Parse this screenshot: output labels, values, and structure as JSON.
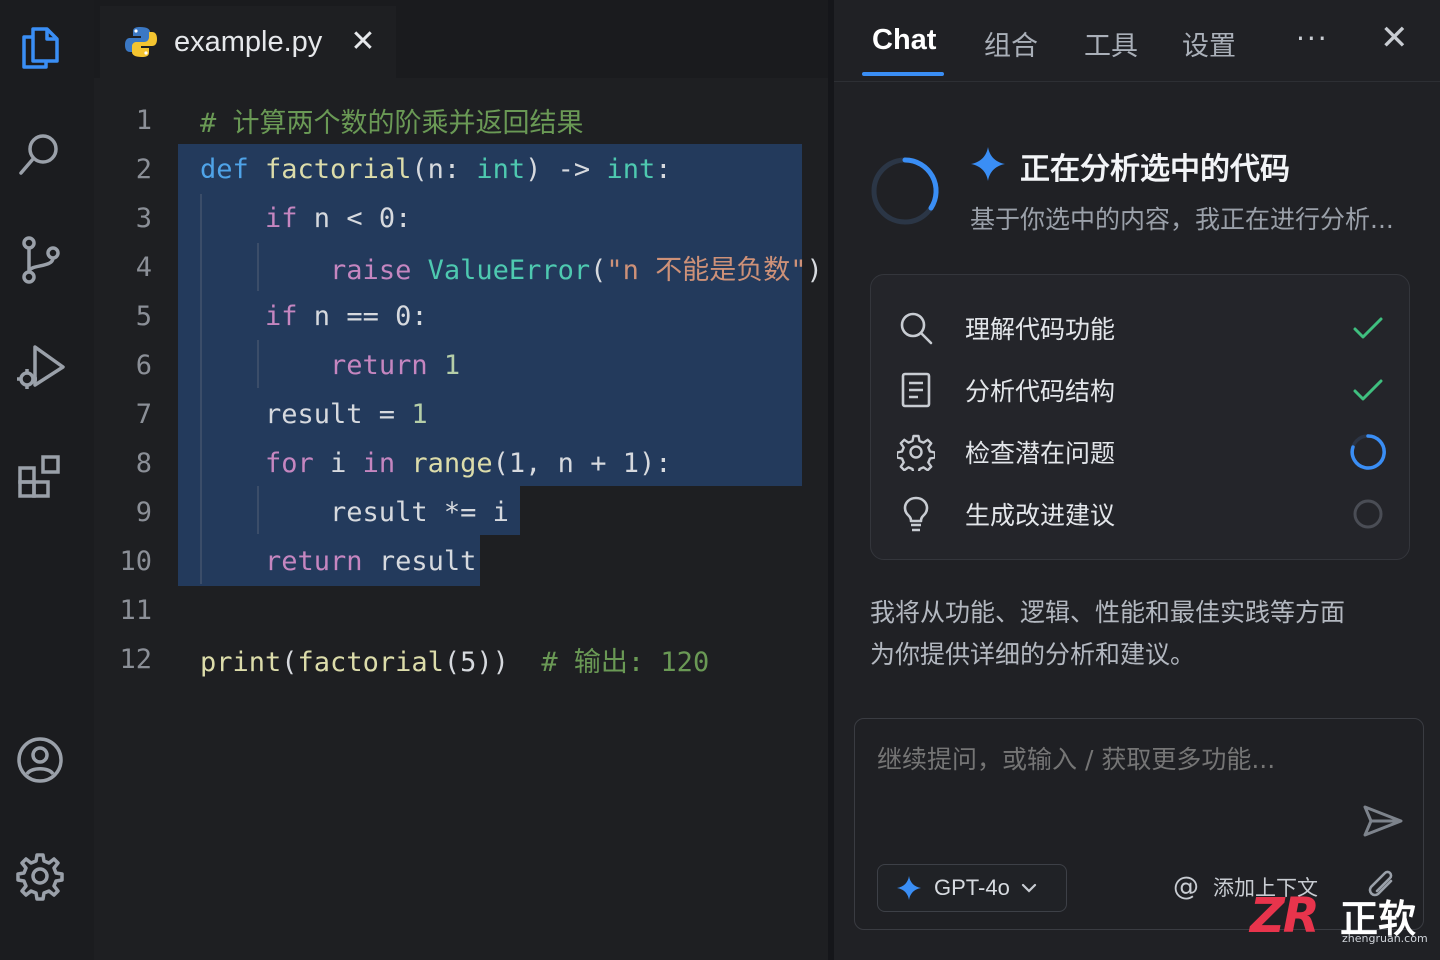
{
  "editor": {
    "tab": {
      "file_name": "example.py",
      "close_glyph": "✕",
      "file_icon": "python-icon"
    },
    "lines": [
      {
        "n": "1",
        "tokens": [
          {
            "t": "# 计算两个数的阶乘并返回结果",
            "c": "cm"
          }
        ]
      },
      {
        "n": "2",
        "tokens": [
          {
            "t": "def ",
            "c": "kw"
          },
          {
            "t": "factorial",
            "c": "fn"
          },
          {
            "t": "(n: ",
            "c": "pl"
          },
          {
            "t": "int",
            "c": "ty"
          },
          {
            "t": ") -> ",
            "c": "pl"
          },
          {
            "t": "int",
            "c": "ty"
          },
          {
            "t": ":",
            "c": "pl"
          }
        ]
      },
      {
        "n": "3",
        "tokens": [
          {
            "t": "    ",
            "c": "pl"
          },
          {
            "t": "if",
            "c": "kwp"
          },
          {
            "t": " n < 0:",
            "c": "pl"
          }
        ]
      },
      {
        "n": "4",
        "tokens": [
          {
            "t": "        ",
            "c": "pl"
          },
          {
            "t": "raise ",
            "c": "kwp"
          },
          {
            "t": "ValueError",
            "c": "ty"
          },
          {
            "t": "(",
            "c": "pl"
          },
          {
            "t": "\"n 不能是负数\"",
            "c": "str"
          },
          {
            "t": ")",
            "c": "pl"
          }
        ]
      },
      {
        "n": "5",
        "tokens": [
          {
            "t": "    ",
            "c": "pl"
          },
          {
            "t": "if",
            "c": "kwp"
          },
          {
            "t": " n == 0:",
            "c": "pl"
          }
        ]
      },
      {
        "n": "6",
        "tokens": [
          {
            "t": "        ",
            "c": "pl"
          },
          {
            "t": "return",
            "c": "kwp"
          },
          {
            "t": " 1",
            "c": "num"
          }
        ]
      },
      {
        "n": "7",
        "tokens": [
          {
            "t": "    result = ",
            "c": "pl"
          },
          {
            "t": "1",
            "c": "num"
          }
        ]
      },
      {
        "n": "8",
        "tokens": [
          {
            "t": "    ",
            "c": "pl"
          },
          {
            "t": "for",
            "c": "kwp"
          },
          {
            "t": " i ",
            "c": "pl"
          },
          {
            "t": "in",
            "c": "kwp"
          },
          {
            "t": " ",
            "c": "pl"
          },
          {
            "t": "range",
            "c": "fn"
          },
          {
            "t": "(1, n + 1):",
            "c": "pl"
          }
        ]
      },
      {
        "n": "9",
        "tokens": [
          {
            "t": "        result *= i",
            "c": "pl"
          }
        ]
      },
      {
        "n": "10",
        "tokens": [
          {
            "t": "    ",
            "c": "pl"
          },
          {
            "t": "return",
            "c": "kwp"
          },
          {
            "t": " result",
            "c": "pl"
          }
        ]
      },
      {
        "n": "11",
        "tokens": []
      },
      {
        "n": "12",
        "tokens": [
          {
            "t": "print",
            "c": "fn"
          },
          {
            "t": "(",
            "c": "pl"
          },
          {
            "t": "factorial",
            "c": "fn"
          },
          {
            "t": "(5))  ",
            "c": "pl"
          },
          {
            "t": "# 输出: 120",
            "c": "cm"
          }
        ]
      }
    ]
  },
  "activity_bar": {
    "top_icons": [
      "files-icon",
      "search-icon",
      "source-control-icon",
      "run-debug-icon",
      "extensions-icon"
    ],
    "bottom_icons": [
      "account-icon",
      "settings-gear-icon"
    ]
  },
  "panel": {
    "tabs": [
      {
        "label": "Chat",
        "active": true
      },
      {
        "label": "组合",
        "active": false
      },
      {
        "label": "工具",
        "active": false
      },
      {
        "label": "设置",
        "active": false
      }
    ],
    "more_label": "···",
    "close_label": "✕",
    "status": {
      "title": "正在分析选中的代码",
      "subtitle": "基于你选中的内容，我正在进行分析..."
    },
    "steps": [
      {
        "label": "理解代码功能",
        "icon": "search-icon",
        "state": "done"
      },
      {
        "label": "分析代码结构",
        "icon": "document-icon",
        "state": "done"
      },
      {
        "label": "检查潜在问题",
        "icon": "gear-icon",
        "state": "in-progress"
      },
      {
        "label": "生成改进建议",
        "icon": "lightbulb-icon",
        "state": "pending"
      }
    ],
    "summary_line1": "我将从功能、逻辑、性能和最佳实践等方面",
    "summary_line2": "为你提供详细的分析和建议。",
    "input": {
      "placeholder": "继续提问，或输入 / 获取更多功能...",
      "model": "GPT-4o",
      "add_context": "添加上下文"
    },
    "accent_color": "#3a8ef5",
    "check_color": "#3fbf7f"
  },
  "watermark": {
    "logo": "ZR",
    "brand": "正软",
    "url": "zhengruan.com"
  }
}
